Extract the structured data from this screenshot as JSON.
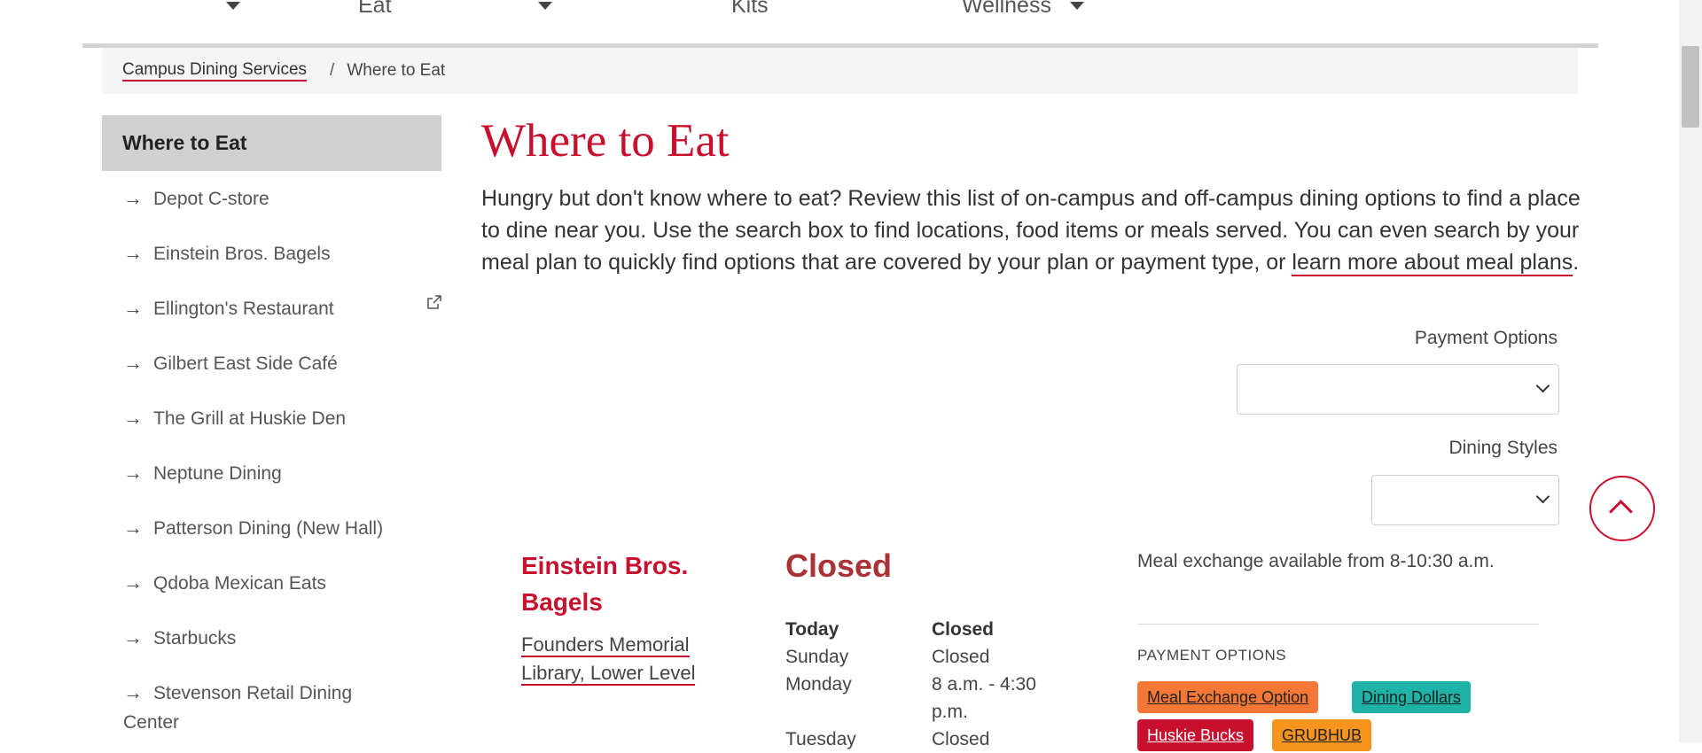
{
  "nav": {
    "items": [
      "Eat",
      "Kits",
      "Wellness"
    ]
  },
  "breadcrumb": {
    "home": "Campus Dining Services",
    "separator": "/",
    "current": "Where to Eat"
  },
  "sidebar": {
    "heading": "Where to Eat",
    "arrow": "→",
    "items": [
      {
        "label": "Depot C-store"
      },
      {
        "label": "Einstein Bros. Bagels"
      },
      {
        "label": "Ellington's Restaurant",
        "external": true
      },
      {
        "label": "Gilbert East Side Café"
      },
      {
        "label": "The Grill at Huskie Den"
      },
      {
        "label": "Neptune Dining"
      },
      {
        "label": "Patterson Dining (New Hall)"
      },
      {
        "label": "Qdoba Mexican Eats"
      },
      {
        "label": "Starbucks"
      },
      {
        "label": "Stevenson Retail Dining Center"
      }
    ]
  },
  "main": {
    "title": "Where to Eat",
    "intro": "Hungry but don't know where to eat? Review this list of on-campus and off-campus dining options to find a place to dine near you. Use the search box to find locations, food items or meals served. You can even search by your meal plan to quickly find options that are covered by your plan or payment type, or ",
    "intro_link": "learn more about meal plans",
    "intro_end": "."
  },
  "filters": {
    "payment_label": "Payment Options",
    "payment_value": "",
    "styles_label": "Dining Styles",
    "styles_value": ""
  },
  "location": {
    "name": "Einstein Bros. Bagels",
    "address": "Founders Memorial Library, Lower Level",
    "status": "Closed",
    "hours": [
      {
        "day": "Today",
        "time": "Closed",
        "bold": true
      },
      {
        "day": "Sunday",
        "time": "Closed"
      },
      {
        "day": "Monday",
        "time": "8 a.m. - 4:30 p.m."
      },
      {
        "day": "Tuesday",
        "time": "Closed"
      }
    ],
    "note": "Meal exchange available from 8-10:30 a.m.",
    "payment_heading": "PAYMENT OPTIONS",
    "payment_badges": [
      {
        "label": "Meal Exchange Option",
        "bg": "#f47735",
        "color": "#222"
      },
      {
        "label": "Dining Dollars",
        "bg": "#1fb3a7",
        "color": "#222"
      },
      {
        "label": "Huskie Bucks",
        "bg": "#c8102e",
        "color": "#ffffff"
      },
      {
        "label": "GRUBHUB",
        "bg": "#f7941d",
        "color": "#222"
      }
    ]
  },
  "colors": {
    "accent": "#c8102e",
    "status_closed": "#a83236"
  }
}
